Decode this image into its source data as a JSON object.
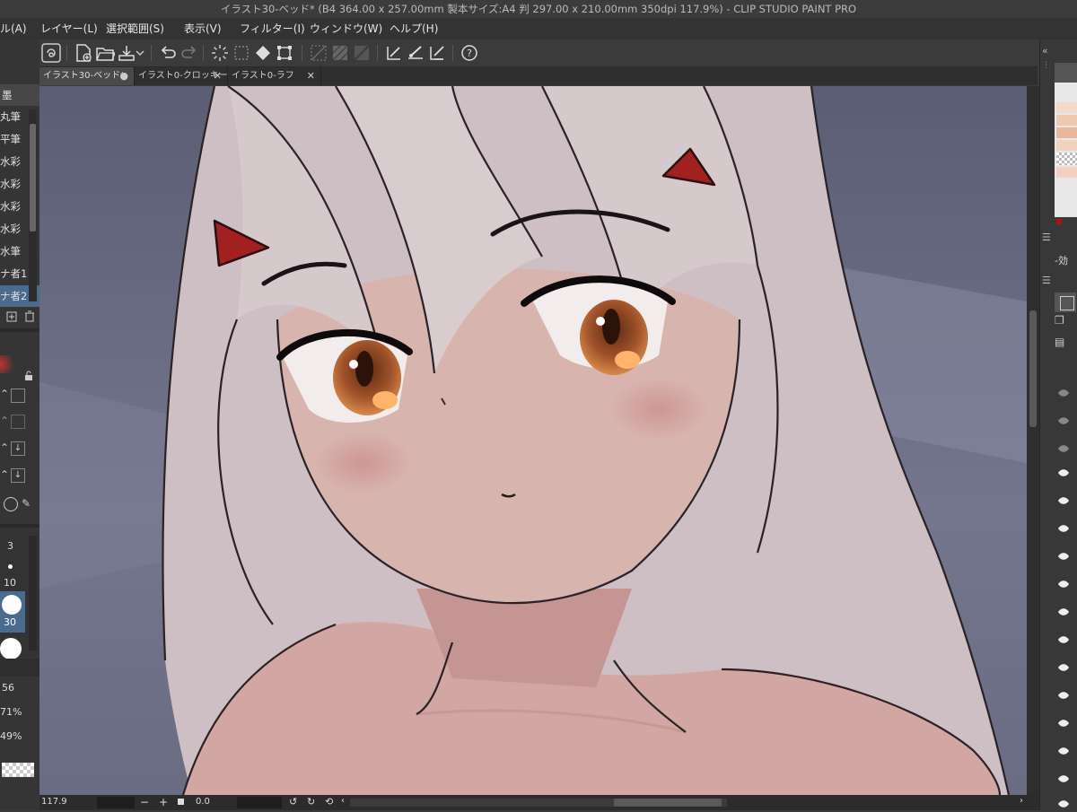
{
  "window": {
    "title": "イラスト30-ベッド* (B4 364.00 x 257.00mm 製本サイズ:A4 判 297.00 x 210.00mm 350dpi 117.9%) - CLIP STUDIO PAINT PRO"
  },
  "menu": {
    "items": [
      "ル(A)",
      "レイヤー(L)",
      "選択範囲(S)",
      "表示(V)",
      "フィルター(I)",
      "ウィンドウ(W)",
      "ヘルプ(H)"
    ]
  },
  "tabs": [
    {
      "label": "イラスト30-ベッド*",
      "close": "●"
    },
    {
      "label": "イラスト0-クロッキー",
      "close": "✕"
    },
    {
      "label": "イラスト0-ラフ",
      "close": "✕"
    }
  ],
  "left_panel": {
    "header": "墨",
    "brushes": [
      "丸筆",
      "平筆",
      "水彩",
      "水彩",
      "水彩",
      "水彩",
      "水筆",
      "ナ者1",
      "ナ者2"
    ],
    "size_values": [
      "3",
      "10",
      "30"
    ],
    "percents": [
      "56",
      "71%",
      "49%"
    ]
  },
  "status": {
    "zoom": "117.9",
    "minus": "−",
    "plus": "+",
    "angle": "0.0"
  },
  "right_panel": {
    "effect_label": "効"
  },
  "colors": {
    "accent": "#4a6b8e",
    "canvas_bg": "#6b6d82",
    "hair": "#d9cccf",
    "skin": "#d9b3ad",
    "eye": "#b05a2c",
    "horn": "#a32020"
  }
}
